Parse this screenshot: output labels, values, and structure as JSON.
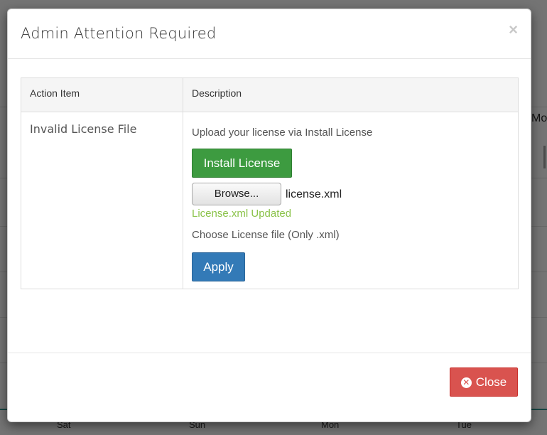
{
  "background": {
    "col_header_fragment": "Mo",
    "days": [
      "Sat",
      "Sun",
      "Mon",
      "Tue"
    ]
  },
  "modal": {
    "title": "Admin Attention Required",
    "close_x": "×",
    "table": {
      "headers": [
        "Action Item",
        "Description"
      ],
      "row": {
        "action_item": "Invalid License File",
        "description": {
          "upload_text": "Upload your license via Install License",
          "install_button": "Install License",
          "browse_button": "Browse...",
          "file_name": "license.xml",
          "status": "License.xml Updated",
          "choose_text": "Choose License file (Only .xml)",
          "apply_button": "Apply"
        }
      }
    },
    "footer": {
      "close_button": "Close"
    }
  },
  "colors": {
    "install": "#3d9b40",
    "apply": "#337ab7",
    "close": "#d9534f",
    "status": "#8bc34a"
  }
}
